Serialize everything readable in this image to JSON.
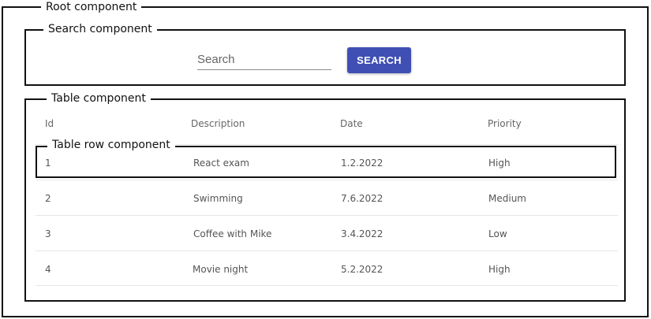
{
  "labels": {
    "root": "Root component",
    "search": "Search component",
    "table": "Table component",
    "table_row": "Table row component"
  },
  "search": {
    "placeholder": "Search",
    "button_label": "SEARCH"
  },
  "table": {
    "headers": [
      "Id",
      "Description",
      "Date",
      "Priority"
    ],
    "rows": [
      [
        "1",
        "React exam",
        "1.2.2022",
        "High"
      ],
      [
        "2",
        "Swimming",
        "7.6.2022",
        "Medium"
      ],
      [
        "3",
        "Coffee with Mike",
        "3.4.2022",
        "Low"
      ],
      [
        "4",
        "Movie night",
        "5.2.2022",
        "High"
      ]
    ]
  },
  "colors": {
    "button": "#3f4fb4",
    "frame": "#111111"
  }
}
